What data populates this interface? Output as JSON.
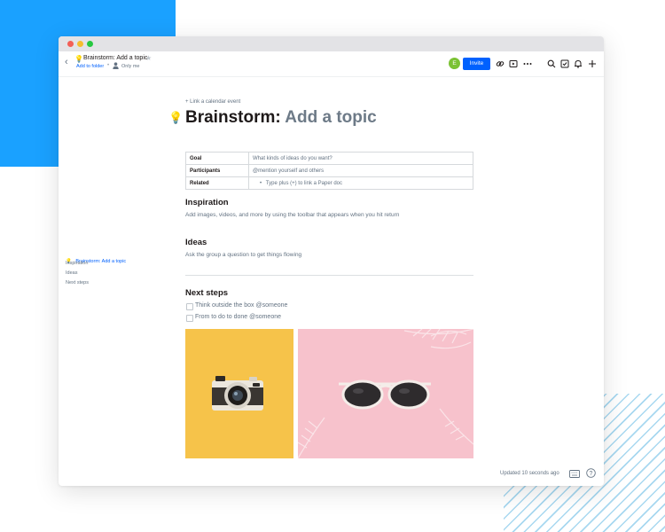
{
  "window": {
    "controls": [
      "close",
      "minimize",
      "zoom"
    ]
  },
  "header": {
    "doc_icon": "lightbulb-icon",
    "doc_title": "Brainstorm: Add a topic",
    "add_to_folder": "Add to folder",
    "separator": "•",
    "visibility": "Only me",
    "avatar_initial": "E",
    "avatar_color": "#7bc234",
    "invite_label": "Invite",
    "icons": [
      "link-icon",
      "present-icon",
      "more-icon",
      "search-icon",
      "checklist-icon",
      "bell-icon",
      "plus-icon"
    ]
  },
  "document": {
    "calendar_link": "+ Link a calendar event",
    "title_prefix": "Brainstorm:",
    "title_placeholder": "Add a topic",
    "meta_table": [
      {
        "key": "Goal",
        "value": "What kinds of ideas do you want?"
      },
      {
        "key": "Participants",
        "value": "@mention yourself and others"
      },
      {
        "key": "Related",
        "value": "Type plus (+) to link a Paper doc"
      }
    ],
    "sections": [
      {
        "heading": "Inspiration",
        "body": "Add images, videos, and more by using the toolbar that appears when you hit return"
      },
      {
        "heading": "Ideas",
        "body": "Ask the group a question to get things flowing"
      }
    ],
    "next_steps": {
      "heading": "Next steps",
      "items": [
        "Think outside the box @someone",
        "From to do to done @someone"
      ]
    },
    "images": [
      "camera-on-yellow-photo",
      "sunglasses-on-pink-photo"
    ]
  },
  "toc": {
    "items": [
      {
        "label": "Brainstorm: Add a topic",
        "active": true
      },
      {
        "label": "Inspiration",
        "active": false
      },
      {
        "label": "Ideas",
        "active": false
      },
      {
        "label": "Next steps",
        "active": false
      }
    ]
  },
  "footer": {
    "updated": "Updated 10 seconds ago",
    "icons": [
      "keyboard-icon",
      "help-icon"
    ]
  },
  "colors": {
    "accent": "#0061fe",
    "decor_blue": "#1aa1ff",
    "photo_yellow": "#f6c34a",
    "photo_pink": "#f7c2cc"
  }
}
